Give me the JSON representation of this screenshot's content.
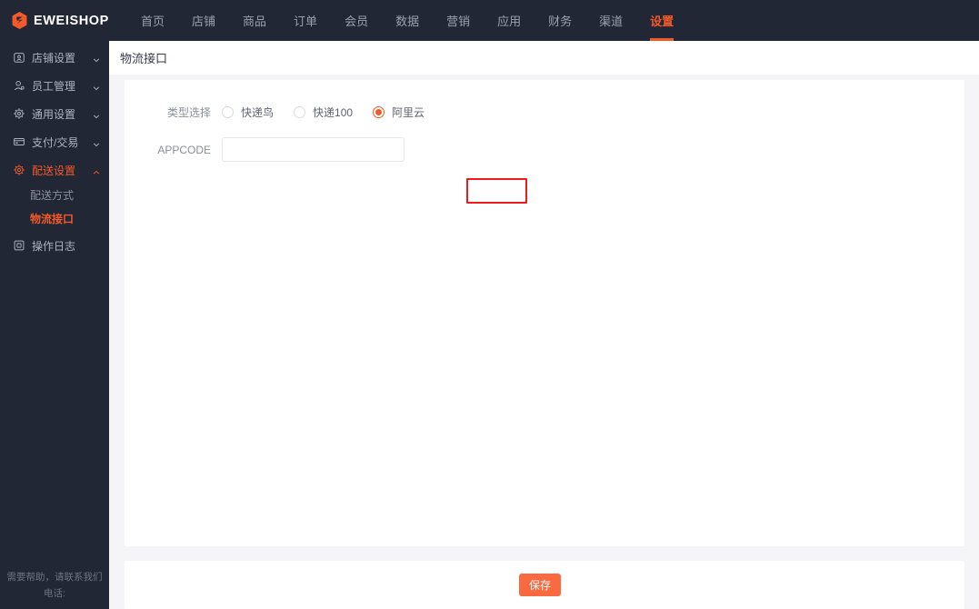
{
  "brand": {
    "name": "EWEISHOP",
    "logo_icon": "hexagon-logo-icon",
    "accent_color": "#f4592a"
  },
  "topnav": {
    "items": [
      {
        "label": "首页",
        "active": false
      },
      {
        "label": "店铺",
        "active": false
      },
      {
        "label": "商品",
        "active": false
      },
      {
        "label": "订单",
        "active": false
      },
      {
        "label": "会员",
        "active": false
      },
      {
        "label": "数据",
        "active": false
      },
      {
        "label": "营销",
        "active": false
      },
      {
        "label": "应用",
        "active": false
      },
      {
        "label": "财务",
        "active": false
      },
      {
        "label": "渠道",
        "active": false
      },
      {
        "label": "设置",
        "active": true
      }
    ]
  },
  "sidebar": {
    "items": [
      {
        "label": "店铺设置",
        "icon": "shop-icon",
        "caret": "chevron-down-icon",
        "active": false
      },
      {
        "label": "员工管理",
        "icon": "user-icon",
        "caret": "chevron-down-icon",
        "active": false
      },
      {
        "label": "通用设置",
        "icon": "gear-icon",
        "caret": "chevron-down-icon",
        "active": false
      },
      {
        "label": "支付/交易",
        "icon": "card-icon",
        "caret": "chevron-down-icon",
        "active": false
      },
      {
        "label": "配送设置",
        "icon": "gear-icon",
        "caret": "chevron-up-icon",
        "active": true
      }
    ],
    "sub_items": [
      {
        "label": "配送方式",
        "active": false
      },
      {
        "label": "物流接口",
        "active": true
      }
    ],
    "last_item": {
      "label": "操作日志",
      "icon": "log-icon",
      "active": false
    },
    "footer_line1": "需要帮助，请联系我们",
    "footer_line2": "电话:"
  },
  "page": {
    "title": "物流接口"
  },
  "form": {
    "type_label": "类型选择",
    "type_options": [
      {
        "label": "快递鸟",
        "checked": false
      },
      {
        "label": "快递100",
        "checked": false
      },
      {
        "label": "阿里云",
        "checked": true
      }
    ],
    "appcode_label": "APPCODE",
    "appcode_value": "",
    "appcode_placeholder": ""
  },
  "footer": {
    "save_label": "保存"
  },
  "annotation": {
    "highlight_color": "#ee1b1b",
    "target": "阿里云"
  }
}
